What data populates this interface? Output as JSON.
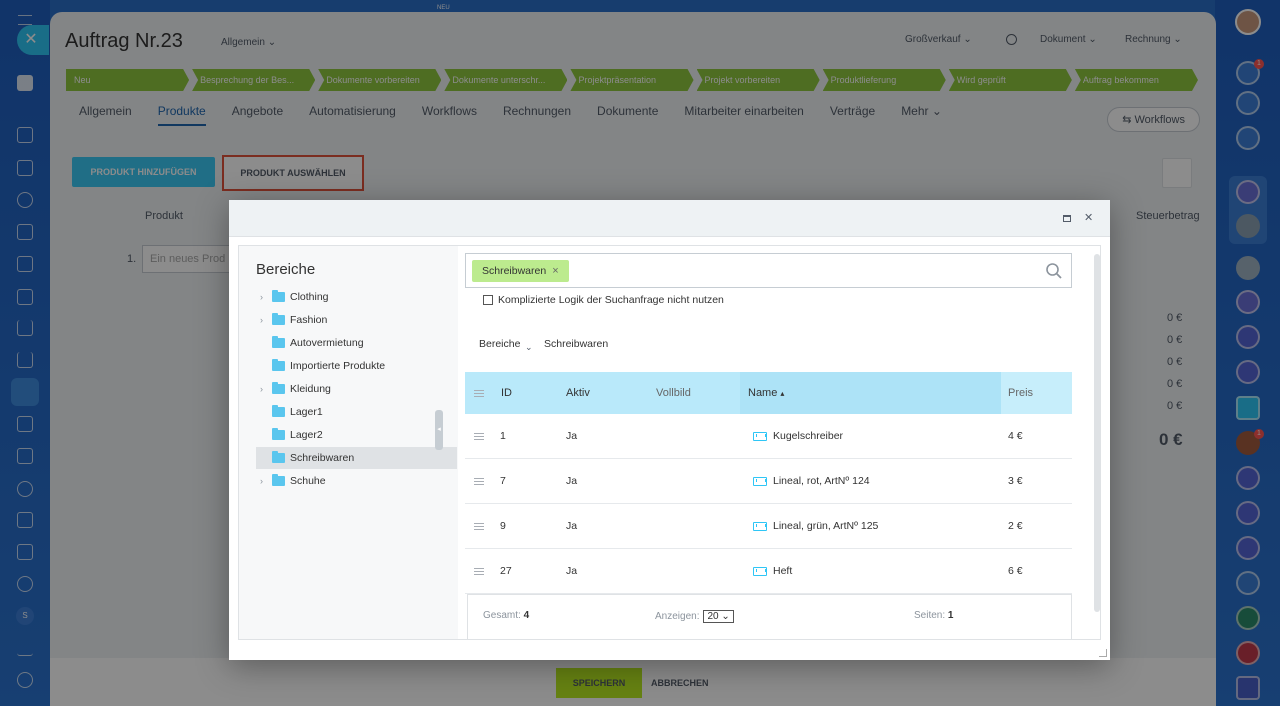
{
  "app": {
    "new_badge": "NEU",
    "title": "Auftrag Nr.23",
    "category": "Allgemein",
    "header_right": [
      "Großverkauf",
      "Dokument",
      "Rechnung"
    ]
  },
  "stages": [
    "Neu",
    "Besprechung der Bes...",
    "Dokumente vorbereiten",
    "Dokumente unterschr...",
    "Projektpräsentation",
    "Projekt vorbereiten",
    "Produktlieferung",
    "Wird geprüft",
    "Auftrag bekommen"
  ],
  "tabs": [
    "Allgemein",
    "Produkte",
    "Angebote",
    "Automatisierung",
    "Workflows",
    "Rechnungen",
    "Dokumente",
    "Mitarbeiter einarbeiten",
    "Verträge",
    "Mehr"
  ],
  "workflows_button": "Workflows",
  "toolbar": {
    "add_product": "PRODUKT HINZUFÜGEN",
    "select_product": "PRODUKT AUSWÄHLEN"
  },
  "product_table_bg": {
    "col_product": "Produkt",
    "col_tax": "Steuerbetrag",
    "row_num": "1.",
    "placeholder": "Ein neues Prod",
    "totals": [
      "0 €",
      "0 €",
      "0 €",
      "0 €",
      "0 €"
    ],
    "grand_total": "0 €"
  },
  "footer": {
    "save": "SPEICHERN",
    "cancel": "ABBRECHEN"
  },
  "modal": {
    "tree_title": "Bereiche",
    "tree_items": [
      {
        "label": "Clothing",
        "expandable": true
      },
      {
        "label": "Fashion",
        "expandable": true
      },
      {
        "label": "Autovermietung",
        "expandable": false
      },
      {
        "label": "Importierte Produkte",
        "expandable": false
      },
      {
        "label": "Kleidung",
        "expandable": true
      },
      {
        "label": "Lager1",
        "expandable": false
      },
      {
        "label": "Lager2",
        "expandable": false
      },
      {
        "label": "Schreibwaren",
        "expandable": false,
        "selected": true
      },
      {
        "label": "Schuhe",
        "expandable": true
      }
    ],
    "search_chip": "Schreibwaren",
    "checkbox_label": "Komplizierte Logik der Suchanfrage nicht nutzen",
    "breadcrumb": [
      "Bereiche",
      "Schreibwaren"
    ],
    "columns": {
      "id": "ID",
      "active": "Aktiv",
      "image": "Vollbild",
      "name": "Name",
      "price": "Preis"
    },
    "rows": [
      {
        "id": "1",
        "active": "Ja",
        "name": "Kugelschreiber",
        "price": "4 €"
      },
      {
        "id": "7",
        "active": "Ja",
        "name": "Lineal, rot, ArtNº 124",
        "price": "3 €"
      },
      {
        "id": "9",
        "active": "Ja",
        "name": "Lineal, grün, ArtNº 125",
        "price": "2 €"
      },
      {
        "id": "27",
        "active": "Ja",
        "name": "Heft",
        "price": "6 €"
      }
    ],
    "footer": {
      "total_label": "Gesamt:",
      "total_value": "4",
      "show_label": "Anzeigen:",
      "show_value": "20",
      "pages_label": "Seiten:",
      "pages_value": "1"
    }
  },
  "right_badges": [
    "1",
    "1"
  ],
  "left_small_label": "S"
}
